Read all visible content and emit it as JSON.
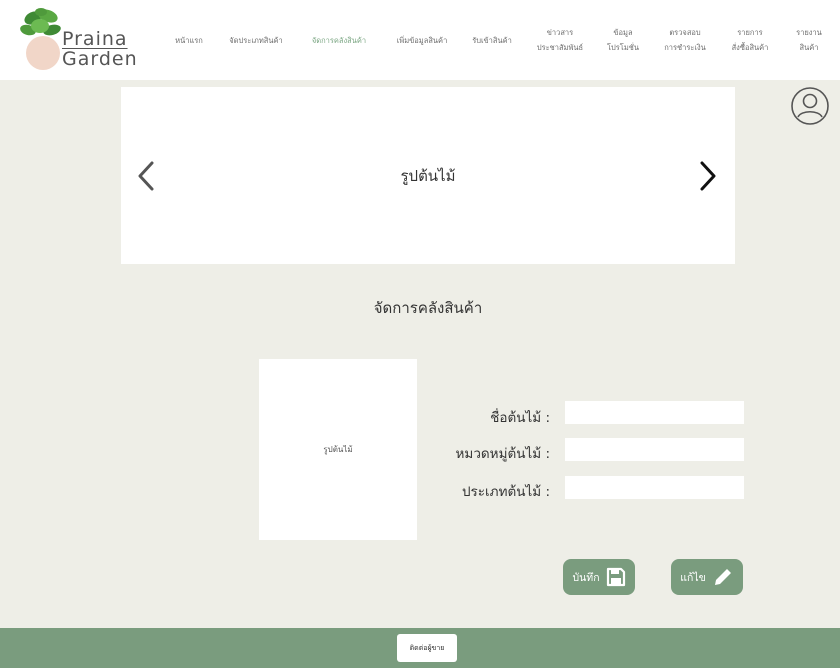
{
  "brand": {
    "name_line1": "Praina",
    "name_line2": "Garden"
  },
  "nav": [
    {
      "label": "หน้าแรก"
    },
    {
      "label": "จัดประเภทสินค้า"
    },
    {
      "label": "จัดการคลังสินค้า"
    },
    {
      "label": "เพิ่มข้อมูลสินค้า"
    },
    {
      "label": "รับเข้าสินค้า"
    },
    {
      "label": "ข่าวสาร\nประชาสัมพันธ์"
    },
    {
      "label": "ข้อมูล\nโปรโมชั่น"
    },
    {
      "label": "ตรวจสอบ\nการชำระเงิน"
    },
    {
      "label": "รายการ\nสั่งซื้อสินค้า"
    },
    {
      "label": "รายงาน\nสินค้า"
    }
  ],
  "slider": {
    "image_label": "รูปต้นไม้"
  },
  "page": {
    "title": "จัดการคลังสินค้า"
  },
  "form": {
    "photo_label": "รูปต้นไม้",
    "fields": [
      {
        "label": "ชื่อต้นไม้ :",
        "value": ""
      },
      {
        "label": "หมวดหมู่ต้นไม้ :",
        "value": ""
      },
      {
        "label": "ประเภทต้นไม้ :",
        "value": ""
      }
    ],
    "save_label": "บันทึก",
    "edit_label": "แก้ไข"
  },
  "footer": {
    "contact_label": "ติดต่อผู้ขาย"
  },
  "colors": {
    "accent": "#7a9c7e",
    "nav_active": "#7ca784",
    "background": "#eeeee7"
  },
  "icons": [
    "plant-icon",
    "user-icon",
    "chevron-left-icon",
    "chevron-right-icon",
    "save-icon",
    "pencil-icon"
  ]
}
